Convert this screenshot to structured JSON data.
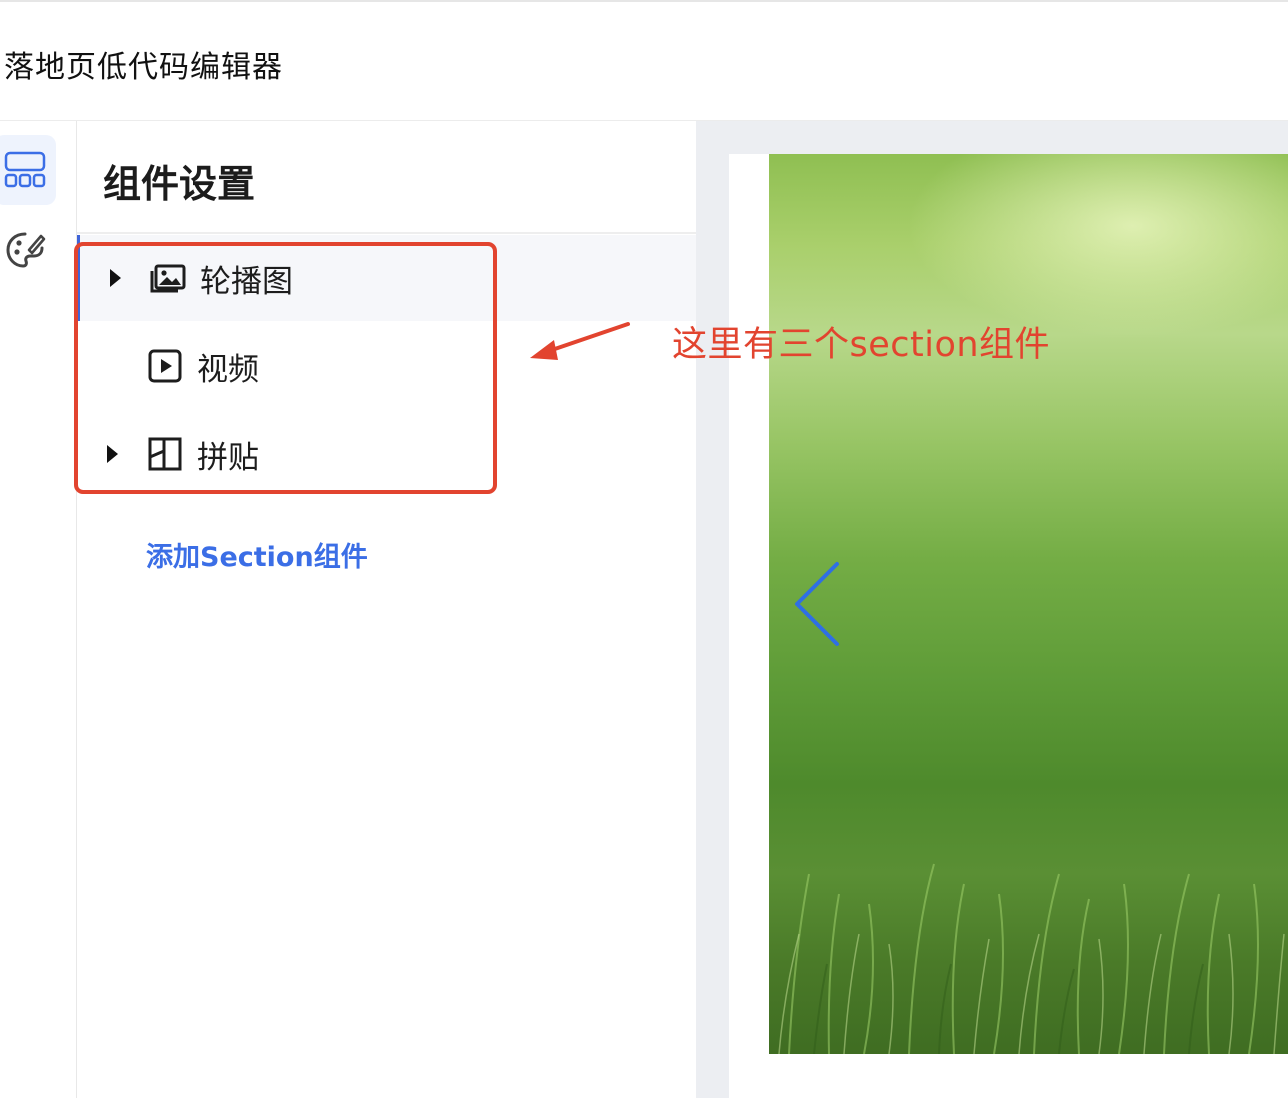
{
  "app": {
    "title": "落地页低代码编辑器"
  },
  "rail": {
    "items": [
      {
        "icon": "layout-blocks-icon",
        "active": true
      },
      {
        "icon": "palette-icon",
        "active": false
      }
    ]
  },
  "panel": {
    "title": "组件设置",
    "items": [
      {
        "label": "轮播图",
        "icon": "image-icon",
        "expandable": true,
        "selected": true
      },
      {
        "label": "视频",
        "icon": "video-play-icon",
        "expandable": false,
        "selected": false
      },
      {
        "label": "拼贴",
        "icon": "collage-grid-icon",
        "expandable": true,
        "selected": false
      }
    ],
    "add_label": "添加Section组件"
  },
  "annotation": {
    "text": "这里有三个section组件",
    "color": "#e2442f"
  },
  "colors": {
    "accent": "#3b6ee6",
    "annotation": "#e2442f",
    "canvas_bg": "#eceef2"
  }
}
